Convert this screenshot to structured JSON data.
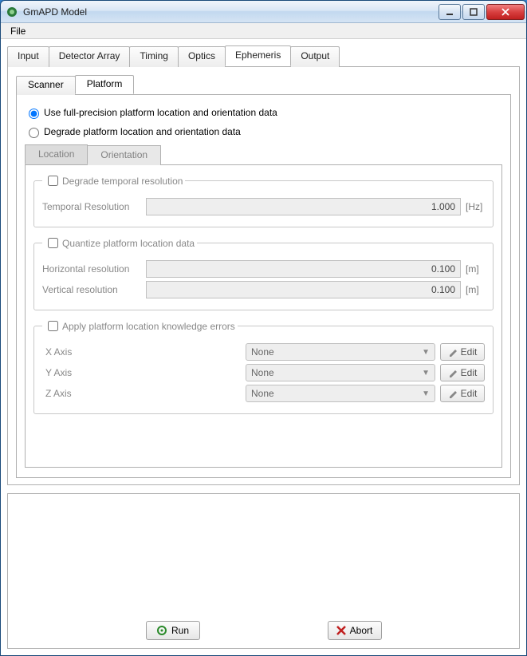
{
  "window": {
    "title": "GmAPD Model"
  },
  "menu": {
    "file": "File"
  },
  "tabs": {
    "main": [
      "Input",
      "Detector Array",
      "Timing",
      "Optics",
      "Ephemeris",
      "Output"
    ],
    "main_active": 4,
    "inner": [
      "Scanner",
      "Platform"
    ],
    "inner_active": 1,
    "sub": [
      "Location",
      "Orientation"
    ],
    "sub_active": 0
  },
  "radios": {
    "full": "Use full-precision platform location and orientation data",
    "degrade": "Degrade platform location and orientation data"
  },
  "groups": {
    "temporal": {
      "legend": "Degrade temporal resolution",
      "label": "Temporal Resolution",
      "value": "1.000",
      "unit": "[Hz]"
    },
    "quantize": {
      "legend": "Quantize platform location data",
      "h_label": "Horizontal resolution",
      "h_value": "0.100",
      "h_unit": "[m]",
      "v_label": "Vertical resolution",
      "v_value": "0.100",
      "v_unit": "[m]"
    },
    "errors": {
      "legend": "Apply platform location knowledge errors",
      "axes": [
        {
          "label": "X Axis",
          "value": "None"
        },
        {
          "label": "Y Axis",
          "value": "None"
        },
        {
          "label": "Z Axis",
          "value": "None"
        }
      ],
      "edit": "Edit"
    }
  },
  "buttons": {
    "run": "Run",
    "abort": "Abort"
  }
}
